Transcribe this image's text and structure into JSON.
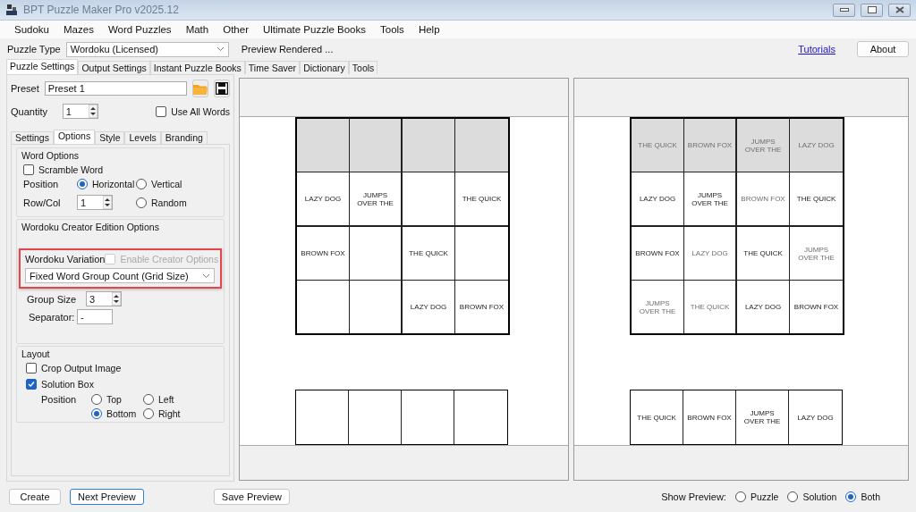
{
  "window": {
    "title": "BPT Puzzle Maker Pro v2025.12"
  },
  "menu": [
    "Sudoku",
    "Mazes",
    "Word Puzzles",
    "Math",
    "Other",
    "Ultimate Puzzle Books",
    "Tools",
    "Help"
  ],
  "toolbar": {
    "puzzle_type_label": "Puzzle Type",
    "puzzle_type": "Wordoku (Licensed)",
    "status": "Preview Rendered ...",
    "tutorials_link": "Tutorials",
    "about_button": "About"
  },
  "tabs": [
    {
      "label": "Puzzle Settings",
      "selected": true
    },
    {
      "label": "Output Settings",
      "selected": false
    },
    {
      "label": "Instant Puzzle Books",
      "selected": false
    },
    {
      "label": "Time Saver",
      "selected": false
    },
    {
      "label": "Dictionary",
      "selected": false
    },
    {
      "label": "Tools",
      "selected": false
    }
  ],
  "settings": {
    "preset_label": "Preset",
    "preset": "Preset 1",
    "quantity_label": "Quantity",
    "quantity": "1",
    "use_all_words": {
      "label": "Use All Words",
      "checked": false
    },
    "subtabs": [
      {
        "label": "Settings",
        "selected": false
      },
      {
        "label": "Options",
        "selected": true
      },
      {
        "label": "Style",
        "selected": false
      },
      {
        "label": "Levels",
        "selected": false
      },
      {
        "label": "Branding",
        "selected": false
      }
    ],
    "word_options": {
      "title": "Word Options",
      "scramble": {
        "label": "Scramble Word",
        "checked": false
      },
      "position_label": "Position",
      "row_col_label": "Row/Col",
      "row_col": "1",
      "positions": [
        {
          "label": "Horizontal",
          "selected": true
        },
        {
          "label": "Vertical",
          "selected": false
        },
        {
          "label": "Random",
          "selected": false
        }
      ]
    },
    "creator": {
      "title": "Wordoku Creator Edition Options",
      "variation_label": "Wordoku Variation",
      "enable_creator": {
        "label": "Enable Creator Options",
        "checked": false,
        "disabled": true
      },
      "variation": "Fixed Word Group Count (Grid Size)",
      "highlighted": true,
      "group_size_label": "Group Size",
      "group_size": "3",
      "separator_label": "Separator:",
      "separator": "-"
    },
    "layout": {
      "title": "Layout",
      "crop": {
        "label": "Crop Output Image",
        "checked": false
      },
      "solution_box": {
        "label": "Solution Box",
        "checked": true
      },
      "position_label": "Position",
      "positions": [
        {
          "label": "Top",
          "selected": false
        },
        {
          "label": "Left",
          "selected": false
        },
        {
          "label": "Bottom",
          "selected": true
        },
        {
          "label": "Right",
          "selected": false
        }
      ]
    }
  },
  "previews": [
    {
      "kind": "puzzle",
      "rows": [
        {
          "shaded": true,
          "cells": [
            null,
            null,
            null,
            null
          ]
        },
        {
          "shaded": false,
          "cells": [
            {
              "text": "LAZY DOG",
              "given": true
            },
            {
              "text": "JUMPS\nOVER THE",
              "given": true
            },
            null,
            {
              "text": "THE QUICK",
              "given": true
            }
          ]
        },
        {
          "shaded": false,
          "cells": [
            {
              "text": "BROWN FOX",
              "given": true
            },
            null,
            {
              "text": "THE QUICK",
              "given": true
            },
            null
          ]
        },
        {
          "shaded": false,
          "cells": [
            null,
            null,
            {
              "text": "LAZY DOG",
              "given": true
            },
            {
              "text": "BROWN FOX",
              "given": true
            }
          ]
        }
      ]
    },
    {
      "kind": "solution",
      "rows": [
        {
          "shaded": true,
          "cells": [
            {
              "text": "THE QUICK",
              "given": false
            },
            {
              "text": "BROWN FOX",
              "given": false
            },
            {
              "text": "JUMPS\nOVER THE",
              "given": false
            },
            {
              "text": "LAZY DOG",
              "given": false
            }
          ]
        },
        {
          "shaded": false,
          "cells": [
            {
              "text": "LAZY DOG",
              "given": true
            },
            {
              "text": "JUMPS\nOVER THE",
              "given": true
            },
            {
              "text": "BROWN FOX",
              "given": false
            },
            {
              "text": "THE QUICK",
              "given": true
            }
          ]
        },
        {
          "shaded": false,
          "cells": [
            {
              "text": "BROWN FOX",
              "given": true
            },
            {
              "text": "LAZY DOG",
              "given": false
            },
            {
              "text": "THE QUICK",
              "given": true
            },
            {
              "text": "JUMPS\nOVER THE",
              "given": false
            }
          ]
        },
        {
          "shaded": false,
          "cells": [
            {
              "text": "JUMPS\nOVER THE",
              "given": false
            },
            {
              "text": "THE QUICK",
              "given": false
            },
            {
              "text": "LAZY DOG",
              "given": true
            },
            {
              "text": "BROWN FOX",
              "given": true
            }
          ]
        }
      ],
      "answer": [
        {
          "text": "THE QUICK",
          "given": true
        },
        {
          "text": "BROWN FOX",
          "given": true
        },
        {
          "text": "JUMPS\nOVER THE",
          "given": true
        },
        {
          "text": "LAZY DOG",
          "given": true
        }
      ]
    }
  ],
  "bottom": {
    "buttons": [
      {
        "label": "Create",
        "focused": false
      },
      {
        "label": "Next Preview",
        "focused": true
      },
      {
        "label": "Save Preview",
        "focused": false
      }
    ],
    "show_preview_label": "Show Preview:",
    "show_preview": [
      {
        "label": "Puzzle",
        "selected": false
      },
      {
        "label": "Solution",
        "selected": false
      },
      {
        "label": "Both",
        "selected": true
      }
    ]
  }
}
